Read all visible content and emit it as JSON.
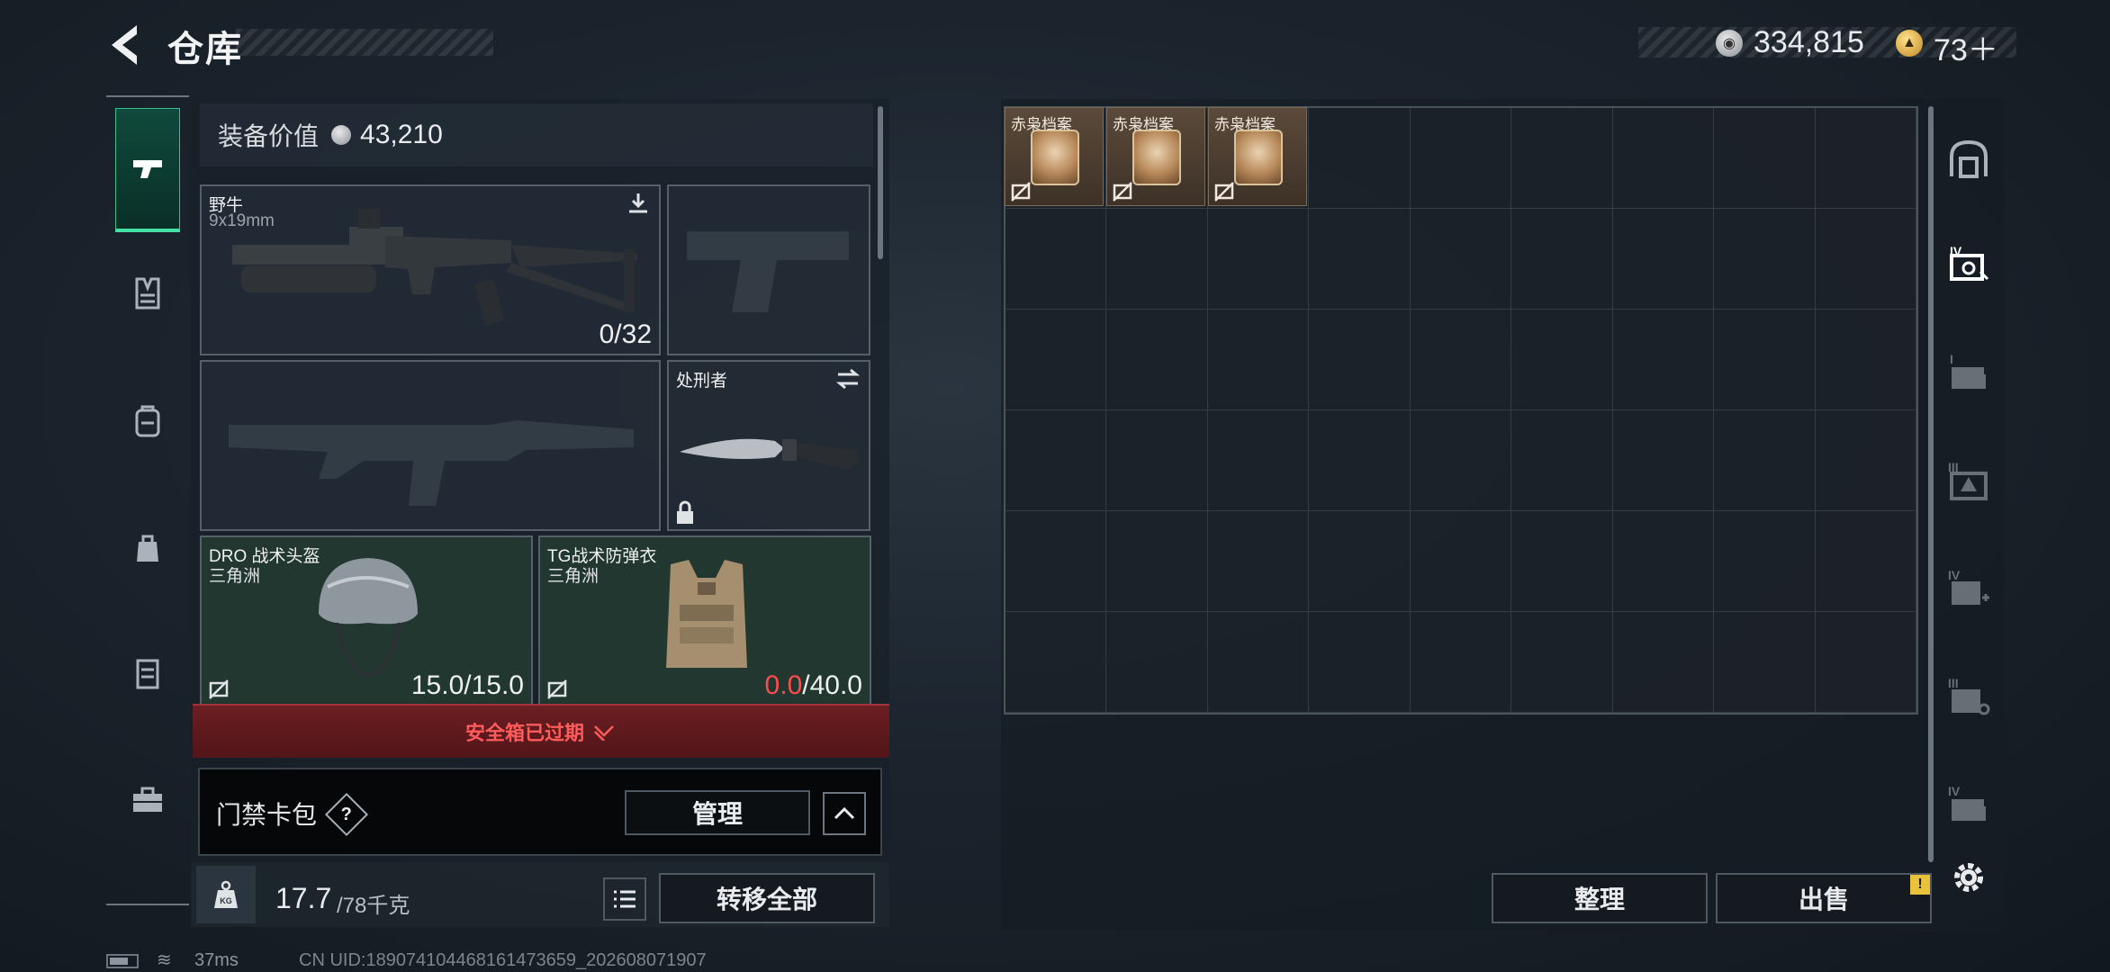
{
  "header": {
    "title": "仓库",
    "currency_silver": "334,815",
    "currency_gold": "73＋"
  },
  "left_rail": {
    "items": [
      "weapon",
      "vest",
      "backpack",
      "bag",
      "case",
      "toolbox"
    ],
    "active": "weapon"
  },
  "equipment": {
    "value_label": "装备价值",
    "value": "43,210",
    "primary": {
      "name": "野牛",
      "ammo_type": "9x19mm",
      "ammo": "0/32"
    },
    "melee": {
      "name": "处刑者"
    },
    "helmet": {
      "name": "DRO 战术头盔",
      "sub": "三角洲",
      "durability": "15.0/15.0"
    },
    "armor": {
      "name": "TG战术防弹衣",
      "sub": "三角洲",
      "durability_current": "0.0",
      "durability_max": "/40.0"
    },
    "safebox_status": "安全箱已过期",
    "keycard": {
      "label": "门禁卡包",
      "help": "?",
      "manage_label": "管理"
    },
    "weight_current": "17.7",
    "weight_max": "/78千克",
    "transfer_all_label": "转移全部"
  },
  "storage": {
    "grid_cols": 9,
    "grid_rows": 6,
    "items": [
      {
        "label": "赤枭档案"
      },
      {
        "label": "赤枭档案"
      },
      {
        "label": "赤枭档案"
      }
    ],
    "sort_label": "整理",
    "sell_label": "出售",
    "sell_alert": "!"
  },
  "right_rail": {
    "items": [
      "storage-main",
      "tier-iv-case",
      "tier-i-case",
      "tier-iii-warning",
      "tier-iv-medical",
      "tier-iii-key",
      "tier-iv-folder"
    ]
  },
  "status_bar": {
    "ping": "37ms",
    "uid": "CN UID:189074104468161473659_202608071907"
  },
  "colors": {
    "accent_green": "#45e0a5",
    "alert_red": "#ff5b5b",
    "safebox_bg": "#6b1e22",
    "item_bg": "#5b4a3a"
  }
}
